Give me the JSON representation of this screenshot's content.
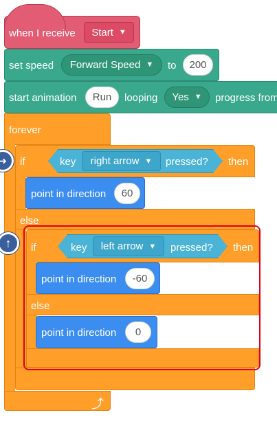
{
  "event_block": {
    "text": "when I receive",
    "message": "Start"
  },
  "set_block": {
    "text": "set speed",
    "variable": "Forward Speed",
    "to": "to",
    "value": "200"
  },
  "anim_block": {
    "text": "start animation",
    "name": "Run",
    "looping": "looping",
    "looping_value": "Yes",
    "progress": "progress from"
  },
  "forever_block": {
    "text": "forever"
  },
  "if1": {
    "if": "if",
    "key": "key",
    "key_value": "right arrow",
    "pressed": "pressed?",
    "then": "then"
  },
  "point1": {
    "text": "point in direction",
    "value": "60"
  },
  "else1": {
    "text": "else"
  },
  "if2": {
    "if": "if",
    "key": "key",
    "key_value": "left arrow",
    "pressed": "pressed?",
    "then": "then"
  },
  "point2": {
    "text": "point in direction",
    "value": "-60"
  },
  "else2": {
    "text": "else"
  },
  "point3": {
    "text": "point in direction",
    "value": "0"
  },
  "icons": {
    "loop_arrow": "loop-arrow-icon",
    "up_arrow": "up-arrow-icon",
    "caret": "caret-down-icon"
  },
  "colors": {
    "events": "#e25c73",
    "variables": "#3aa88c",
    "control": "#ff9f2a",
    "motion": "#3c8df0",
    "sensing": "#4ab3d6",
    "highlight": "#e0001b"
  }
}
